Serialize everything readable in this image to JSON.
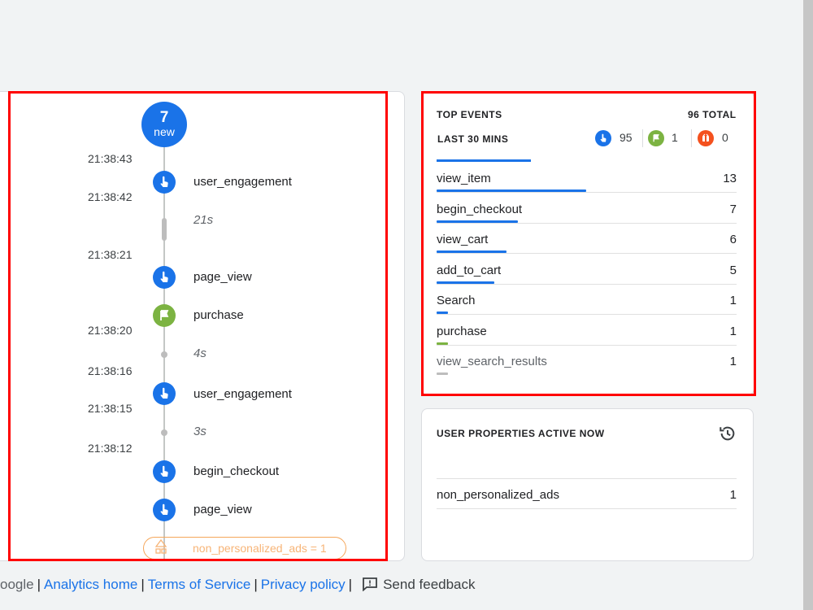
{
  "timeline": {
    "new_count": "7",
    "new_label": "new",
    "timestamps": [
      "21:38:43",
      "21:38:42",
      "21:38:21",
      "21:38:20",
      "21:38:16",
      "21:38:15",
      "21:38:12"
    ],
    "events": [
      {
        "name": "user_engagement",
        "icon": "touch-icon",
        "color": "#1a73e8"
      },
      {
        "name": "page_view",
        "icon": "touch-icon",
        "color": "#1a73e8"
      },
      {
        "name": "purchase",
        "icon": "flag-icon",
        "color": "#7cb342"
      },
      {
        "name": "user_engagement",
        "icon": "touch-icon",
        "color": "#1a73e8"
      },
      {
        "name": "begin_checkout",
        "icon": "touch-icon",
        "color": "#1a73e8"
      },
      {
        "name": "page_view",
        "icon": "touch-icon",
        "color": "#1a73e8"
      }
    ],
    "gaps": [
      "21s",
      "4s",
      "3s"
    ],
    "user_property": "non_personalized_ads = 1"
  },
  "top_events": {
    "title": "TOP EVENTS",
    "total": "96 TOTAL",
    "tab_label": "LAST 30 MINS",
    "counts": [
      {
        "icon": "touch-icon",
        "value": "95",
        "color": "#1a73e8"
      },
      {
        "icon": "flag-icon",
        "value": "1",
        "color": "#7cb342"
      },
      {
        "icon": "error-icon",
        "value": "0",
        "color": "#f4511e"
      }
    ],
    "rows": [
      {
        "name": "view_item",
        "count": "13",
        "share": 0.135,
        "bar_color": "#1a73e8"
      },
      {
        "name": "begin_checkout",
        "count": "7",
        "share": 0.073,
        "bar_color": "#1a73e8"
      },
      {
        "name": "view_cart",
        "count": "6",
        "share": 0.063,
        "bar_color": "#1a73e8"
      },
      {
        "name": "add_to_cart",
        "count": "5",
        "share": 0.052,
        "bar_color": "#1a73e8"
      },
      {
        "name": "Search",
        "count": "1",
        "share": 0.01,
        "bar_color": "#1a73e8"
      },
      {
        "name": "purchase",
        "count": "1",
        "share": 0.01,
        "bar_color": "#7cb342"
      },
      {
        "name": "view_search_results",
        "count": "1",
        "share": 0.01,
        "bar_color": "#bdbdbd"
      }
    ]
  },
  "user_properties": {
    "title": "USER PROPERTIES ACTIVE NOW",
    "rows": [
      {
        "name": "non_personalized_ads",
        "value": "1"
      }
    ]
  },
  "footer": {
    "google": "oogle",
    "analytics_home": "Analytics home",
    "terms": "Terms of Service",
    "privacy": "Privacy policy",
    "feedback": "Send feedback"
  },
  "colors": {
    "accent": "#1a73e8",
    "conversion": "#7cb342",
    "error": "#f4511e",
    "highlight": "#ff0000"
  }
}
